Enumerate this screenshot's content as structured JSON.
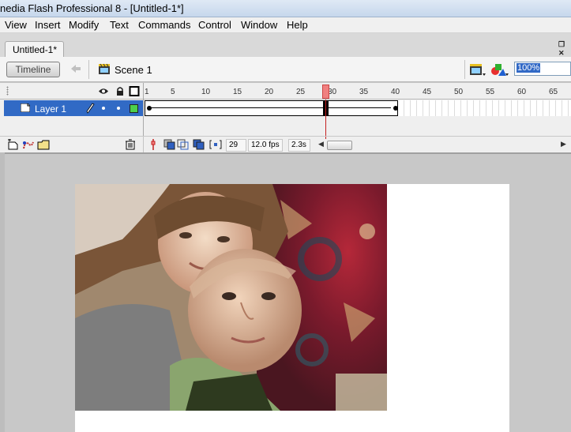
{
  "window": {
    "title": "nedia Flash Professional 8 - [Untitled-1*]"
  },
  "menu": {
    "items": [
      "View",
      "Insert",
      "Modify",
      "Text",
      "Commands",
      "Control",
      "Window",
      "Help"
    ]
  },
  "document": {
    "tab_label": "Untitled-1*"
  },
  "edit_bar": {
    "timeline_label": "Timeline",
    "scene_label": "Scene 1",
    "zoom": "100%"
  },
  "timeline": {
    "ruler_numbers": [
      "1",
      "5",
      "10",
      "15",
      "20",
      "25",
      "30",
      "35",
      "40",
      "45",
      "50",
      "55",
      "60",
      "65"
    ],
    "layer_name": "Layer 1",
    "current_frame": "29",
    "frame_rate": "12.0 fps",
    "elapsed_time": "2.3s"
  },
  "icons": [
    "eye-icon",
    "lock-icon",
    "outline-icon",
    "layer-icon",
    "pencil-icon",
    "insert-layer-icon",
    "add-motion-guide-icon",
    "insert-folder-icon",
    "delete-layer-icon",
    "center-frame-icon",
    "onion-skin-icon",
    "onion-outlines-icon",
    "edit-multiple-frames-icon",
    "modify-onion-markers-icon",
    "scene-icon",
    "edit-scene-icon",
    "edit-symbols-icon",
    "back-arrow-icon"
  ],
  "colors": {
    "selection": "#316ac5",
    "layer_outline": "#4ccf4c",
    "playhead": "#f08080"
  }
}
